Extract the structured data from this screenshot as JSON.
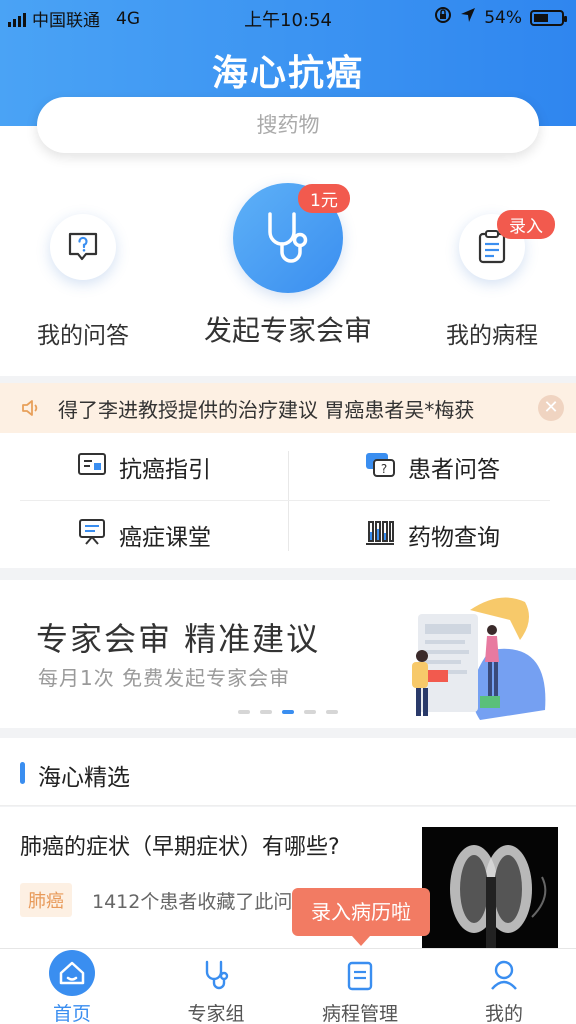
{
  "status_bar": {
    "carrier": "中国联通",
    "network": "4G",
    "time": "上午10:54",
    "battery": "54%",
    "battery_level": 0.54
  },
  "app": {
    "title": "海心抗癌"
  },
  "search": {
    "placeholder": "搜药物"
  },
  "features": [
    {
      "label": "我的问答",
      "icon": "question-chat-icon"
    },
    {
      "label": "发起专家会审",
      "icon": "stethoscope-icon",
      "badge": "1元"
    },
    {
      "label": "我的病程",
      "icon": "clipboard-icon",
      "badge": "录入"
    }
  ],
  "ticker": {
    "text": "得了李进教授提供的治疗建议   胃癌患者吴*梅获"
  },
  "grid": [
    {
      "label": "抗癌指引",
      "icon": "guide-card-icon"
    },
    {
      "label": "患者问答",
      "icon": "question-chat-icon"
    },
    {
      "label": "癌症课堂",
      "icon": "presentation-board-icon"
    },
    {
      "label": "药物查询",
      "icon": "test-tubes-icon"
    }
  ],
  "banner": {
    "title": "专家会审 精准建议",
    "subtitle": "每月1次 免费发起专家会审",
    "active_slide": 3,
    "total_slides": 5
  },
  "section": {
    "title": "海心精选"
  },
  "article": {
    "title": "肺癌的症状（早期症状）有哪些?",
    "tag": "肺癌",
    "meta": "1412个患者收藏了此问"
  },
  "tooltip": {
    "text": "录入病历啦"
  },
  "tabs": [
    {
      "label": "首页",
      "icon": "home-icon",
      "active": true
    },
    {
      "label": "专家组",
      "icon": "stethoscope-icon",
      "active": false
    },
    {
      "label": "病程管理",
      "icon": "clipboard-icon",
      "active": false
    },
    {
      "label": "我的",
      "icon": "user-icon",
      "active": false
    }
  ],
  "colors": {
    "primary": "#3a8ef0",
    "badge": "#f25a4e",
    "ticker_bg": "#fdf0e3",
    "tooltip": "#f27b63"
  }
}
